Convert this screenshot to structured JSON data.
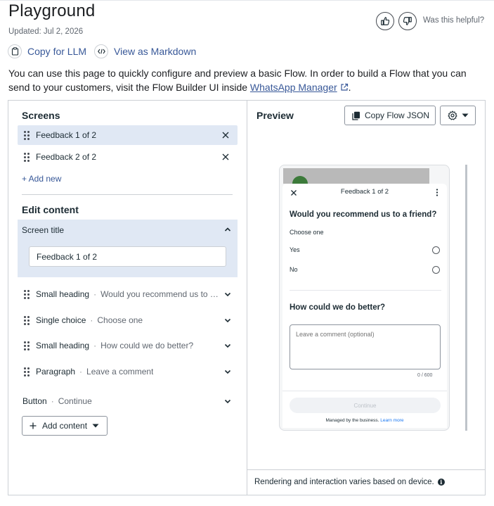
{
  "header": {
    "title": "Playground",
    "updated": "Updated: Jul 2, 2026",
    "helpful_prompt": "Was this helpful?",
    "thumbs_up_icon": "thumbs-up-icon",
    "thumbs_down_icon": "thumbs-down-icon"
  },
  "actions": {
    "copy_for_llm": "Copy for LLM",
    "view_as_markdown": "View as Markdown"
  },
  "intro": {
    "text_before": "You can use this page to quickly configure and preview a basic Flow. In order to build a Flow that you can send to your customers, visit the Flow Builder UI inside ",
    "link": "WhatsApp Manager",
    "text_after": "."
  },
  "screens": {
    "heading": "Screens",
    "items": [
      {
        "label": "Feedback 1 of 2",
        "selected": true
      },
      {
        "label": "Feedback 2 of 2",
        "selected": false
      }
    ],
    "add_new": "+ Add new"
  },
  "edit_content": {
    "heading": "Edit content",
    "screen_title_label": "Screen title",
    "screen_title_value": "Feedback 1 of 2",
    "components": [
      {
        "type": "Small heading",
        "value": "Would you recommend us to a friend?"
      },
      {
        "type": "Single choice",
        "value": "Choose one"
      },
      {
        "type": "Small heading",
        "value": "How could we do better?"
      },
      {
        "type": "Paragraph",
        "value": "Leave a comment"
      }
    ],
    "button": {
      "type": "Button",
      "value": "Continue"
    },
    "add_content": "Add content"
  },
  "preview": {
    "heading": "Preview",
    "copy_json": "Copy Flow JSON",
    "footer_note": "Rendering and interaction varies based on device.",
    "phone": {
      "title": "Feedback 1 of 2",
      "question1": "Would you recommend us to a friend?",
      "choose_one": "Choose one",
      "options": [
        "Yes",
        "No"
      ],
      "question2": "How could we do better?",
      "comment_placeholder": "Leave a comment (optional)",
      "counter": "0 / 600",
      "continue": "Continue",
      "managed_text": "Managed by the business.",
      "learn_more": "Learn more"
    }
  },
  "colors": {
    "link": "#385898",
    "selected_bg": "#e0e8f4",
    "border": "#ccd0d5"
  }
}
